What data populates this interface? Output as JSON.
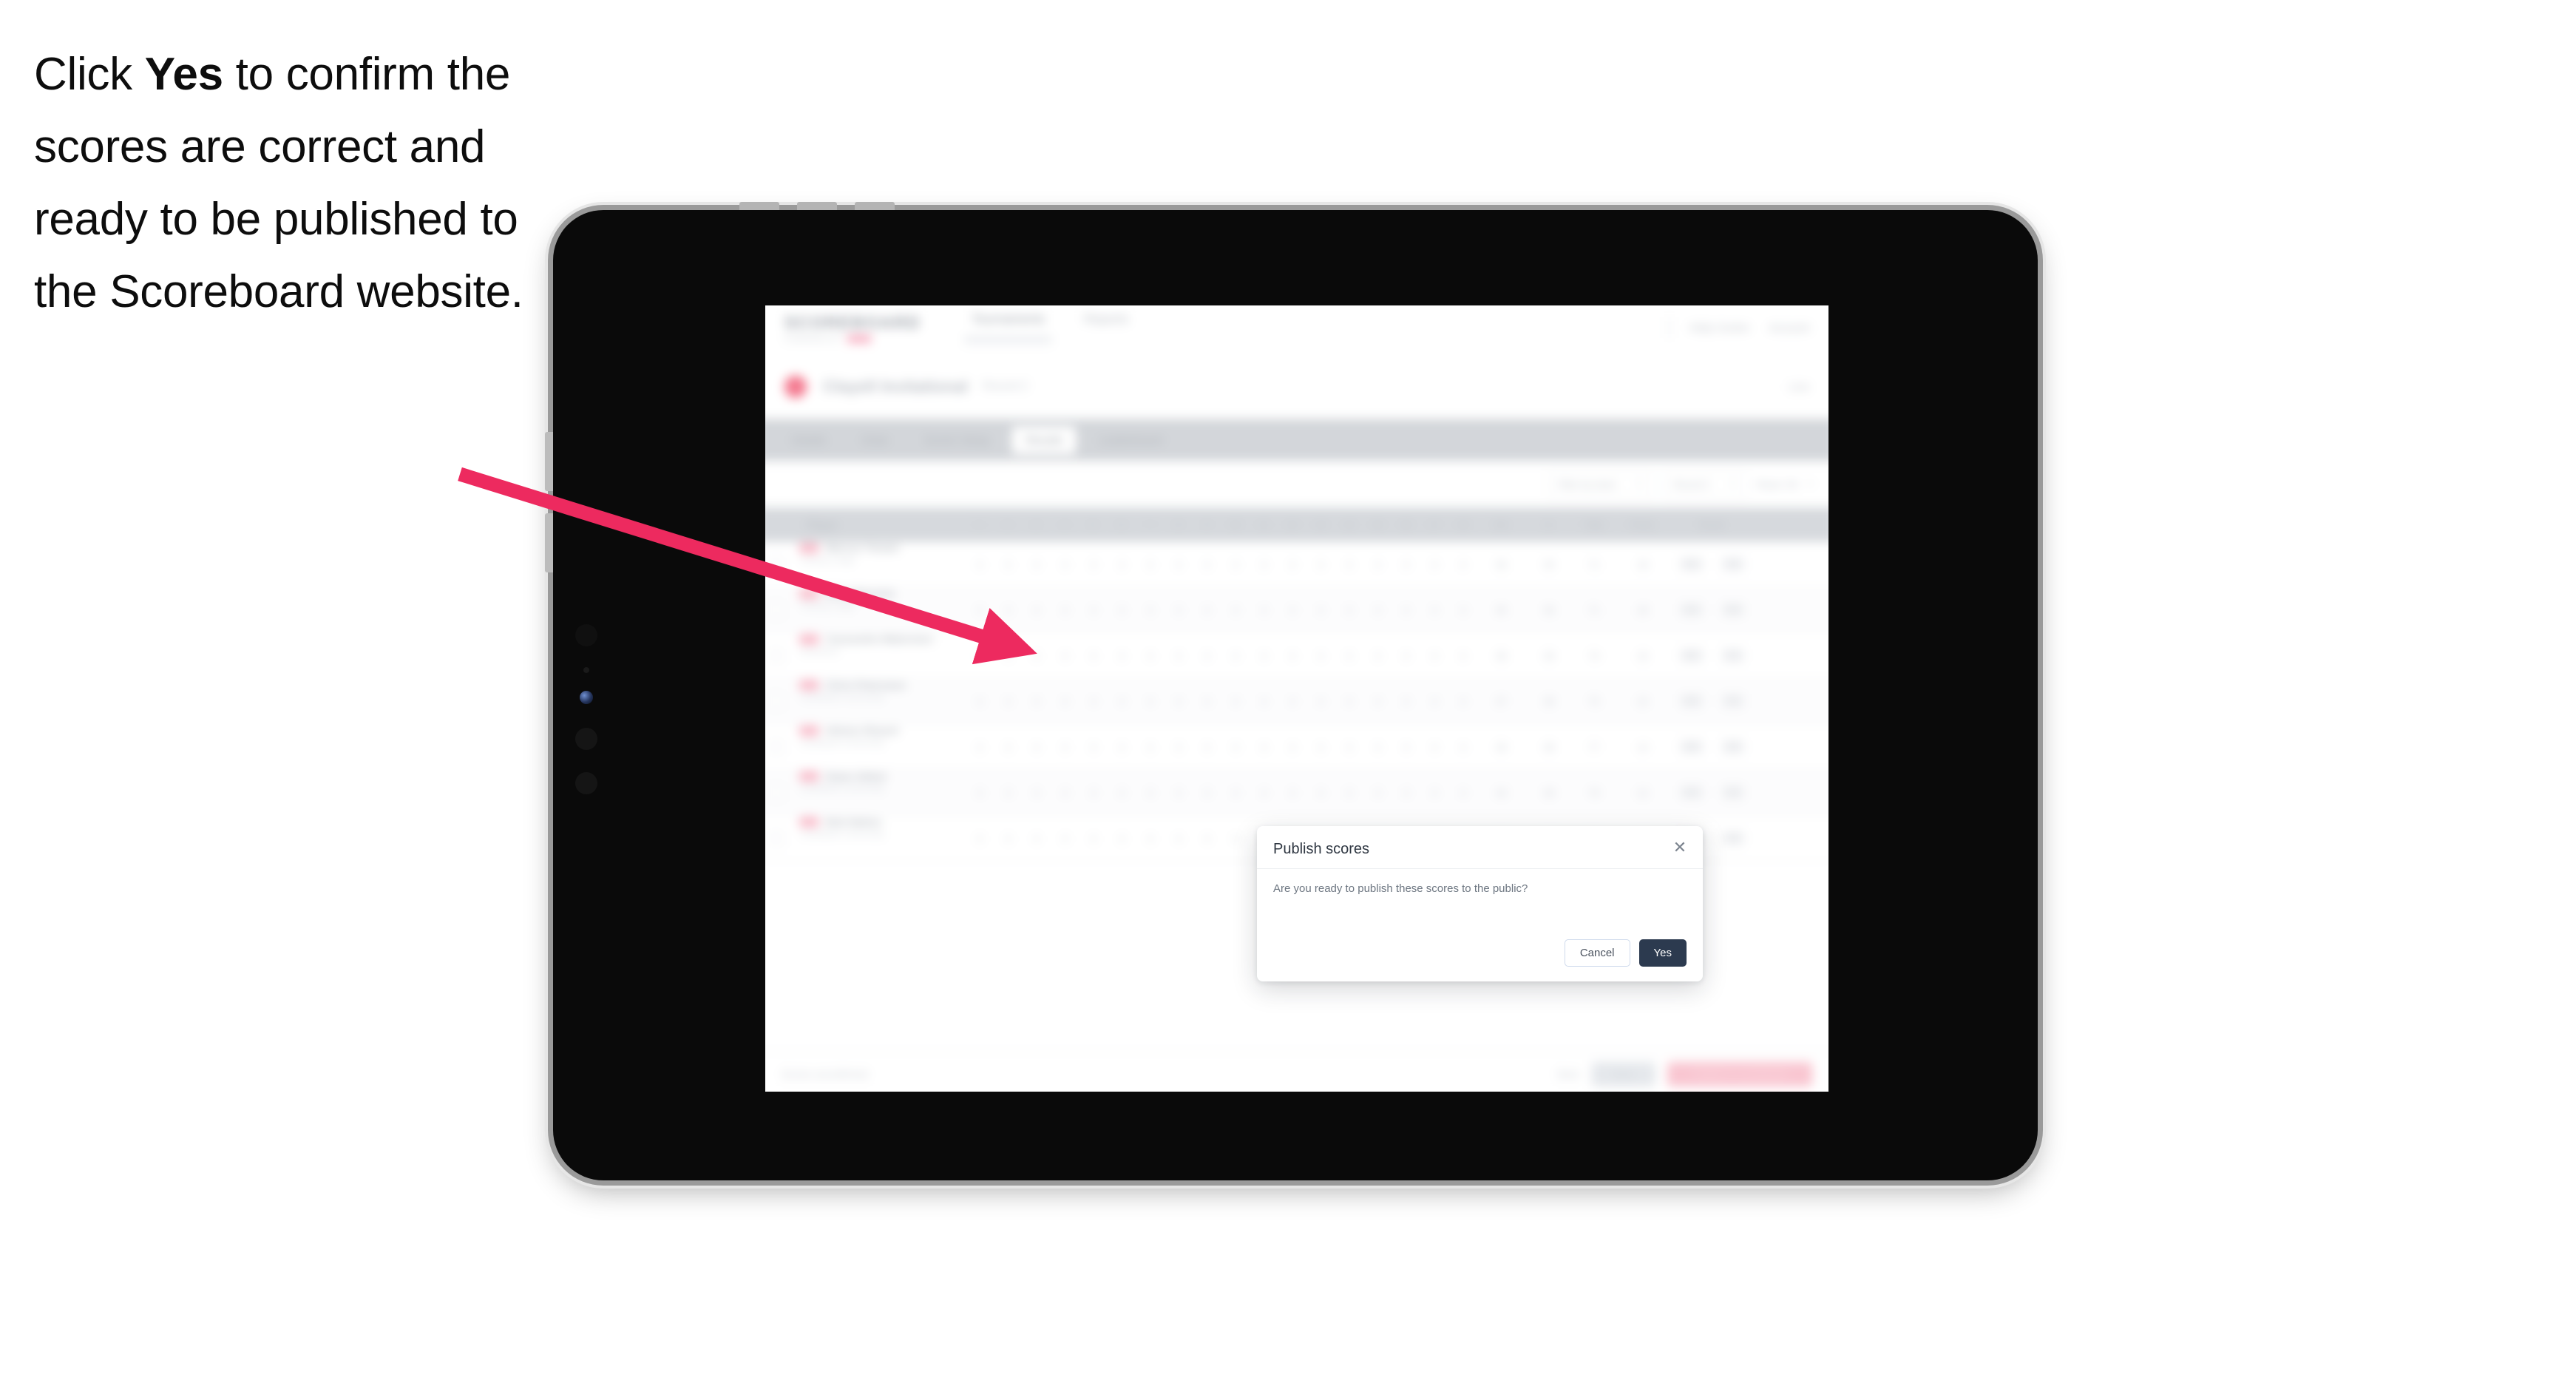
{
  "caption": {
    "part1": "Click ",
    "emphasis": "Yes",
    "part2": " to confirm the scores are correct and ready to be published to the Scoreboard website."
  },
  "colors": {
    "arrow": "#ED2A5F",
    "modal_primary": "#2C3A4F",
    "modal_cancel_border": "#CFDAEC",
    "brand_pink": "#F4798F",
    "publish_button": "#F9C6D1"
  },
  "app": {
    "brand": {
      "name": "SCOREBOARD",
      "subtitle": "POWERED BY",
      "chip": ""
    },
    "nav": [
      {
        "label": "Tournaments",
        "active": true
      },
      {
        "label": "Reports",
        "active": false
      }
    ],
    "nav_right": [
      {
        "label": "Help Centre"
      },
      {
        "label": "Account"
      }
    ],
    "page": {
      "title": "Clayell Invitational",
      "subtitle": "Round 2",
      "right_meta": "Live"
    },
    "tabs": [
      {
        "label": "Details",
        "active": false
      },
      {
        "label": "Draw",
        "active": false
      },
      {
        "label": "Scorer Setup",
        "active": false
      },
      {
        "label": "Results",
        "active": true
      },
      {
        "label": "Leaderboard",
        "active": false
      }
    ],
    "toolbar": {
      "filter_label": "Filter by team",
      "round_label": "Round 2",
      "page_size_label": "Rows: 50"
    },
    "table": {
      "headers_left": [
        "",
        "Player"
      ],
      "headers_holes": [
        "1",
        "2",
        "3",
        "4",
        "5",
        "6",
        "7",
        "8",
        "9",
        "10",
        "11",
        "12",
        "13",
        "14",
        "15",
        "16",
        "17",
        "18"
      ],
      "headers_right": [
        "Out",
        "In",
        "Total",
        "Points",
        "Result"
      ],
      "rows": [
        {
          "rank": "1",
          "name": "Marcus Tenant",
          "club": "Fairway Lodge",
          "out": "36",
          "in": "35",
          "total": "71",
          "points": "18",
          "r1": "A-1",
          "r2": "5-0"
        },
        {
          "rank": "2",
          "name": "Ellen Marwick",
          "club": "Fairway Lodge",
          "out": "35",
          "in": "36",
          "total": "71",
          "points": "18",
          "r1": "A-1",
          "r2": "5-0"
        },
        {
          "rank": "3",
          "name": "Cassandra Waterston",
          "club": "Riverbend",
          "out": "38",
          "in": "36",
          "total": "74",
          "points": "16",
          "r1": "A-2",
          "r2": "4-1"
        },
        {
          "rank": "4",
          "name": "Chris Petersaun",
          "club": "Southbank Community",
          "out": "37",
          "in": "38",
          "total": "75",
          "points": "15",
          "r1": "A-2",
          "r2": "4-1"
        },
        {
          "rank": "5",
          "name": "Helena Shaunt",
          "club": "Southbank Community",
          "out": "39",
          "in": "38",
          "total": "77",
          "points": "14",
          "r1": "A-3",
          "r2": "3-2"
        },
        {
          "rank": "6",
          "name": "Dawn Abbot",
          "club": "Southbank Community",
          "out": "40",
          "in": "39",
          "total": "79",
          "points": "12",
          "r1": "A-3",
          "r2": "3-2"
        },
        {
          "rank": "7",
          "name": "Bob Nation",
          "club": "Southbank Community",
          "out": "41",
          "in": "40",
          "total": "81",
          "points": "10",
          "r1": "A-4",
          "r2": "2-3"
        }
      ],
      "cell_value": "4"
    },
    "action_bar": {
      "status": "Scores unconfirmed",
      "link": "Back",
      "secondary": "Save",
      "primary": "Publish to scoreboard"
    }
  },
  "modal": {
    "title": "Publish scores",
    "message": "Are you ready to publish these scores to the public?",
    "cancel_label": "Cancel",
    "confirm_label": "Yes",
    "close_icon": "close-icon"
  }
}
